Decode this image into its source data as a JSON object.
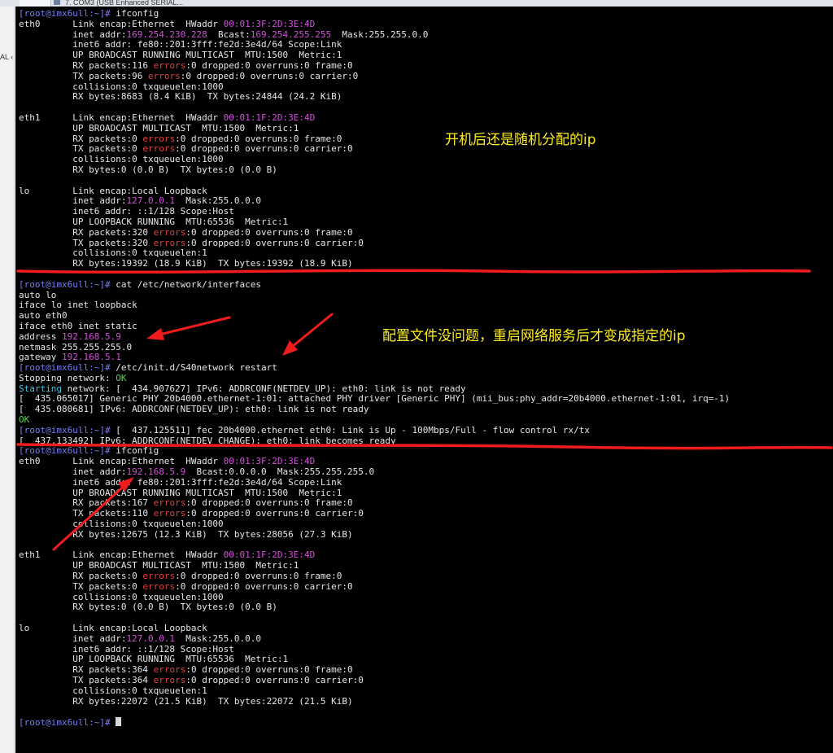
{
  "browser": {
    "tab_label": "7. COM3 (USB Enhanced SERIAL..."
  },
  "sidebar": {
    "clip_text": "AL ‹"
  },
  "colors": {
    "background": "#000000",
    "text": "#e6e6e6",
    "magenta": "#d24fdb",
    "red": "#e34040",
    "green": "#5ad25a",
    "cyan": "#3cc6e0",
    "prompt": "#7a7ef0",
    "annotation": "#ffee22",
    "markup": "#ee1c1c"
  },
  "terminal": {
    "lines": [
      [
        {
          "t": "[root@imx6ull:~]# ",
          "c": "prompt"
        },
        {
          "t": "ifconfig"
        }
      ],
      [
        {
          "t": "eth0      Link encap:Ethernet  HWaddr "
        },
        {
          "t": "00:01:3F:2D:3E:4D",
          "c": "magenta"
        }
      ],
      [
        {
          "t": "          inet addr:"
        },
        {
          "t": "169.254.230.228",
          "c": "magenta"
        },
        {
          "t": "  Bcast:"
        },
        {
          "t": "169.254.255.255",
          "c": "magenta"
        },
        {
          "t": "  Mask:255.255.0.0"
        }
      ],
      [
        {
          "t": "          inet6 addr: fe80::201:3fff:fe2d:3e4d/64 Scope:Link"
        }
      ],
      [
        {
          "t": "          UP BROADCAST RUNNING MULTICAST  MTU:1500  Metric:1"
        }
      ],
      [
        {
          "t": "          RX packets:116 "
        },
        {
          "t": "errors",
          "c": "red"
        },
        {
          "t": ":0 dropped:0 overruns:0 frame:0"
        }
      ],
      [
        {
          "t": "          TX packets:96 "
        },
        {
          "t": "errors",
          "c": "red"
        },
        {
          "t": ":0 dropped:0 overruns:0 carrier:0"
        }
      ],
      [
        {
          "t": "          collisions:0 txqueuelen:1000"
        }
      ],
      [
        {
          "t": "          RX bytes:8683 (8.4 KiB)  TX bytes:24844 (24.2 KiB)"
        }
      ],
      [
        {
          "t": ""
        }
      ],
      [
        {
          "t": "eth1      Link encap:Ethernet  HWaddr "
        },
        {
          "t": "00:01:1F:2D:3E:4D",
          "c": "magenta"
        }
      ],
      [
        {
          "t": "          UP BROADCAST MULTICAST  MTU:1500  Metric:1"
        }
      ],
      [
        {
          "t": "          RX packets:0 "
        },
        {
          "t": "errors",
          "c": "red"
        },
        {
          "t": ":0 dropped:0 overruns:0 frame:0"
        }
      ],
      [
        {
          "t": "          TX packets:0 "
        },
        {
          "t": "errors",
          "c": "red"
        },
        {
          "t": ":0 dropped:0 overruns:0 carrier:0"
        }
      ],
      [
        {
          "t": "          collisions:0 txqueuelen:1000"
        }
      ],
      [
        {
          "t": "          RX bytes:0 (0.0 B)  TX bytes:0 (0.0 B)"
        }
      ],
      [
        {
          "t": ""
        }
      ],
      [
        {
          "t": "lo        Link encap:Local Loopback"
        }
      ],
      [
        {
          "t": "          inet addr:"
        },
        {
          "t": "127.0.0.1",
          "c": "magenta"
        },
        {
          "t": "  Mask:255.0.0.0"
        }
      ],
      [
        {
          "t": "          inet6 addr: ::1/128 Scope:Host"
        }
      ],
      [
        {
          "t": "          UP LOOPBACK RUNNING  MTU:65536  Metric:1"
        }
      ],
      [
        {
          "t": "          RX packets:320 "
        },
        {
          "t": "errors",
          "c": "red"
        },
        {
          "t": ":0 dropped:0 overruns:0 frame:0"
        }
      ],
      [
        {
          "t": "          TX packets:320 "
        },
        {
          "t": "errors",
          "c": "red"
        },
        {
          "t": ":0 dropped:0 overruns:0 carrier:0"
        }
      ],
      [
        {
          "t": "          collisions:0 txqueuelen:1"
        }
      ],
      [
        {
          "t": "          RX bytes:19392 (18.9 KiB)  TX bytes:19392 (18.9 KiB)"
        }
      ],
      [
        {
          "t": ""
        }
      ],
      [
        {
          "t": "[root@imx6ull:~]# ",
          "c": "prompt"
        },
        {
          "t": "cat /etc/network/interfaces"
        }
      ],
      [
        {
          "t": "auto lo"
        }
      ],
      [
        {
          "t": "iface lo inet loopback"
        }
      ],
      [
        {
          "t": "auto eth0"
        }
      ],
      [
        {
          "t": "iface eth0 inet static"
        }
      ],
      [
        {
          "t": "address "
        },
        {
          "t": "192.168.5.9",
          "c": "magenta"
        }
      ],
      [
        {
          "t": "netmask 255.255.255.0"
        }
      ],
      [
        {
          "t": "gateway "
        },
        {
          "t": "192.168.5.1",
          "c": "magenta"
        }
      ],
      [
        {
          "t": "[root@imx6ull:~]# ",
          "c": "prompt"
        },
        {
          "t": "/etc/init.d/S40network restart"
        }
      ],
      [
        {
          "t": "Stopping network: "
        },
        {
          "t": "OK",
          "c": "green"
        }
      ],
      [
        {
          "t": "Starting",
          "c": "cyan"
        },
        {
          "t": " network: [  434.907627] IPv6: ADDRCONF(NETDEV_UP): eth0: link is not ready"
        }
      ],
      [
        {
          "t": "[  435.065017] Generic PHY 20b4000.ethernet-1:01: attached PHY driver [Generic PHY] (mii_bus:phy_addr=20b4000.ethernet-1:01, irq=-1)"
        }
      ],
      [
        {
          "t": "[  435.080681] IPv6: ADDRCONF(NETDEV_UP): eth0: link is not ready"
        }
      ],
      [
        {
          "t": "OK",
          "c": "green"
        }
      ],
      [
        {
          "t": "[root@imx6ull:~]# ",
          "c": "prompt"
        },
        {
          "t": "[  437.125511] fec 20b4000.ethernet eth0: Link is Up - 100Mbps/Full - flow control rx/tx"
        }
      ],
      [
        {
          "t": "[  437.133492] IPv6: ADDRCONF(NETDEV_CHANGE): eth0: link becomes ready"
        }
      ],
      [
        {
          "t": "[root@imx6ull:~]# ",
          "c": "prompt"
        },
        {
          "t": "ifconfig"
        }
      ],
      [
        {
          "t": "eth0      Link encap:Ethernet  HWaddr "
        },
        {
          "t": "00:01:3F:2D:3E:4D",
          "c": "magenta"
        }
      ],
      [
        {
          "t": "          inet addr:"
        },
        {
          "t": "192.168.5.9",
          "c": "magenta"
        },
        {
          "t": "  Bcast:0.0.0.0  Mask:255.255.255.0"
        }
      ],
      [
        {
          "t": "          inet6 addr: fe80::201:3fff:fe2d:3e4d/64 Scope:Link"
        }
      ],
      [
        {
          "t": "          UP BROADCAST RUNNING MULTICAST  MTU:1500  Metric:1"
        }
      ],
      [
        {
          "t": "          RX packets:167 "
        },
        {
          "t": "errors",
          "c": "red"
        },
        {
          "t": ":0 dropped:0 overruns:0 frame:0"
        }
      ],
      [
        {
          "t": "          TX packets:110 "
        },
        {
          "t": "errors",
          "c": "red"
        },
        {
          "t": ":0 dropped:0 overruns:0 carrier:0"
        }
      ],
      [
        {
          "t": "          collisions:0 txqueuelen:1000"
        }
      ],
      [
        {
          "t": "          RX bytes:12675 (12.3 KiB)  TX bytes:28056 (27.3 KiB)"
        }
      ],
      [
        {
          "t": ""
        }
      ],
      [
        {
          "t": "eth1      Link encap:Ethernet  HWaddr "
        },
        {
          "t": "00:01:1F:2D:3E:4D",
          "c": "magenta"
        }
      ],
      [
        {
          "t": "          UP BROADCAST MULTICAST  MTU:1500  Metric:1"
        }
      ],
      [
        {
          "t": "          RX packets:0 "
        },
        {
          "t": "errors",
          "c": "red"
        },
        {
          "t": ":0 dropped:0 overruns:0 frame:0"
        }
      ],
      [
        {
          "t": "          TX packets:0 "
        },
        {
          "t": "errors",
          "c": "red"
        },
        {
          "t": ":0 dropped:0 overruns:0 carrier:0"
        }
      ],
      [
        {
          "t": "          collisions:0 txqueuelen:1000"
        }
      ],
      [
        {
          "t": "          RX bytes:0 (0.0 B)  TX bytes:0 (0.0 B)"
        }
      ],
      [
        {
          "t": ""
        }
      ],
      [
        {
          "t": "lo        Link encap:Local Loopback"
        }
      ],
      [
        {
          "t": "          inet addr:"
        },
        {
          "t": "127.0.0.1",
          "c": "magenta"
        },
        {
          "t": "  Mask:255.0.0.0"
        }
      ],
      [
        {
          "t": "          inet6 addr: ::1/128 Scope:Host"
        }
      ],
      [
        {
          "t": "          UP LOOPBACK RUNNING  MTU:65536  Metric:1"
        }
      ],
      [
        {
          "t": "          RX packets:364 "
        },
        {
          "t": "errors",
          "c": "red"
        },
        {
          "t": ":0 dropped:0 overruns:0 frame:0"
        }
      ],
      [
        {
          "t": "          TX packets:364 "
        },
        {
          "t": "errors",
          "c": "red"
        },
        {
          "t": ":0 dropped:0 overruns:0 carrier:0"
        }
      ],
      [
        {
          "t": "          collisions:0 txqueuelen:1"
        }
      ],
      [
        {
          "t": "          RX bytes:22072 (21.5 KiB)  TX bytes:22072 (21.5 KiB)"
        }
      ],
      [
        {
          "t": ""
        }
      ],
      [
        {
          "t": "[root@imx6ull:~]# ",
          "c": "prompt"
        },
        {
          "t": ""
        }
      ]
    ]
  },
  "annotations": {
    "note1": "开机后还是随机分配的ip",
    "note2": "配置文件没问题，重启网络服务后才变成指定的ip"
  }
}
